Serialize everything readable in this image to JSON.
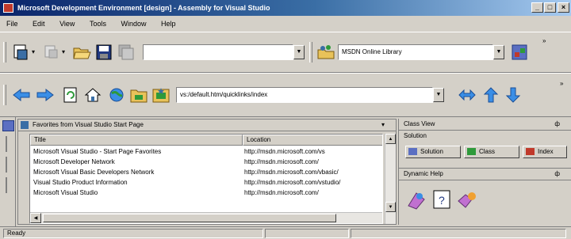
{
  "window": {
    "title": "Microsoft Development Environment [design] - Assembly for Visual Studio",
    "min": "_",
    "restore": "□",
    "close": "×"
  },
  "menu": [
    "File",
    "Edit",
    "View",
    "Tools",
    "Window",
    "Help"
  ],
  "toolbar1": {
    "combo_value": "",
    "combo2_value": "MSDN Online Library"
  },
  "toolbar2": {
    "url": "vs:/default.htm/quicklinks/index"
  },
  "panel": {
    "title": "Favorites from Visual Studio Start Page",
    "columns": [
      "Title",
      "Location"
    ],
    "rows": [
      [
        "Microsoft Visual Studio - Start Page Favorites",
        "http://msdn.microsoft.com/vs"
      ],
      [
        "Microsoft Developer Network",
        "http://msdn.microsoft.com/"
      ],
      [
        "Microsoft Visual Basic Developers Network",
        "http://msdn.microsoft.com/vbasic/"
      ],
      [
        "Visual Studio Product Information",
        "http://msdn.microsoft.com/vstudio/"
      ],
      [
        "Microsoft Visual Studio",
        "http://msdn.microsoft.com/"
      ]
    ]
  },
  "right_pane": {
    "title1": "Class View",
    "subtitle": "Solution",
    "tabs": [
      "Solution",
      "Class",
      "Index"
    ],
    "title2": "Dynamic Help"
  },
  "status": {
    "text": "Ready"
  },
  "colors": {
    "title_start": "#0a246a",
    "title_end": "#a6caf0",
    "face": "#d4d0c8"
  }
}
